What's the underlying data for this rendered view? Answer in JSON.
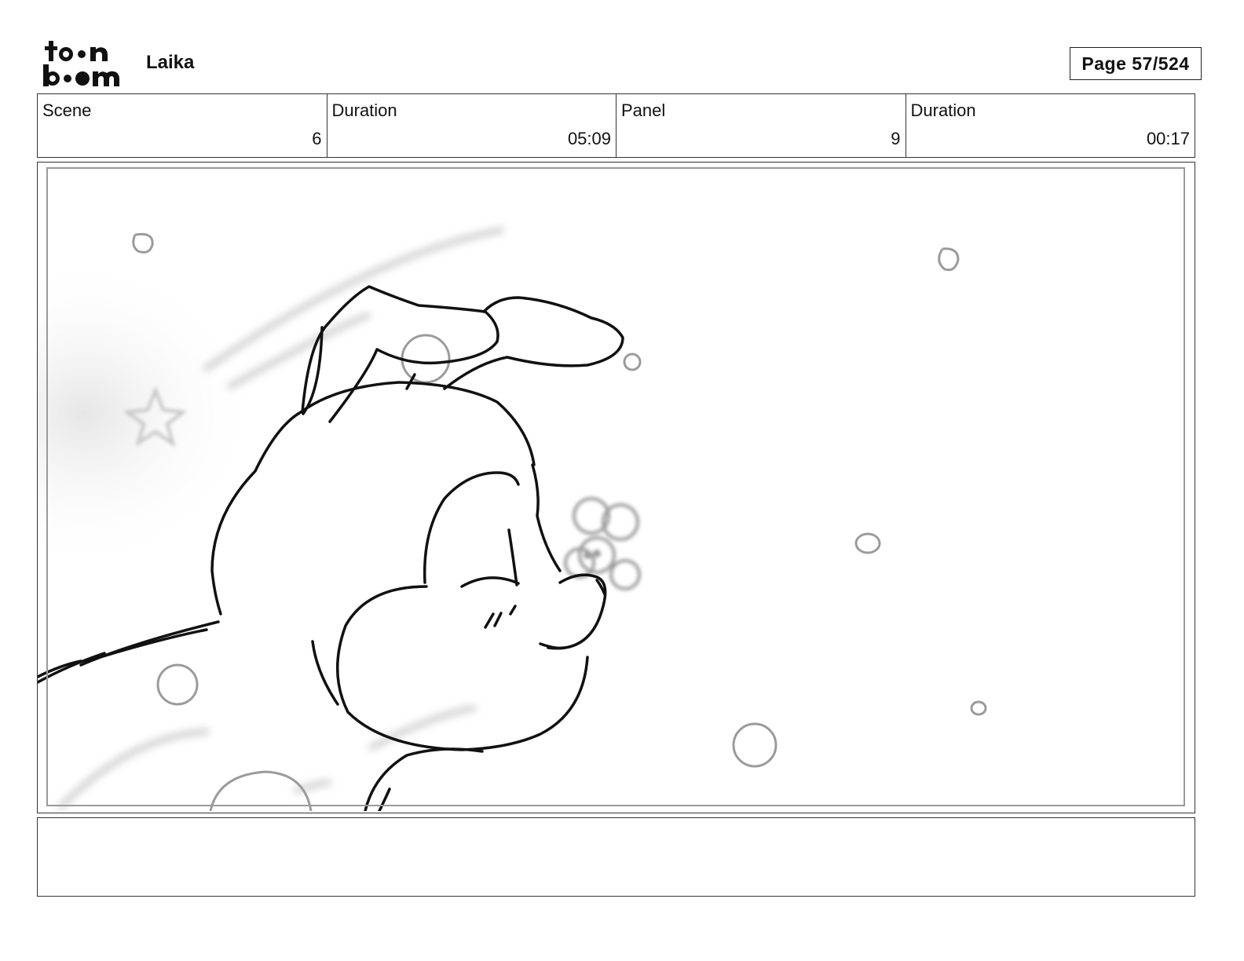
{
  "header": {
    "logo_text": "toon boom",
    "project": "Laika",
    "page": "Page  57/524"
  },
  "info": {
    "scene_label": "Scene",
    "scene_value": "6",
    "scene_duration_label": "Duration",
    "scene_duration_value": "05:09",
    "panel_label": "Panel",
    "panel_value": "9",
    "panel_duration_label": "Duration",
    "panel_duration_value": "00:17"
  },
  "notes": {
    "text": ""
  }
}
